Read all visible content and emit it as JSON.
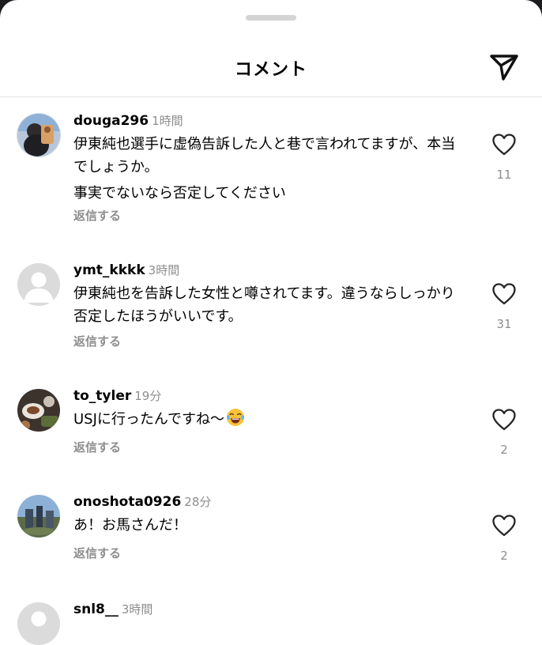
{
  "header": {
    "title": "コメント",
    "share_icon": "paper-plane-icon"
  },
  "comments": [
    {
      "username": "douga296",
      "time": "1時間",
      "lines": [
        "伊東純也選手に虚偽告訴した人と巷で言われてますが、本当でしょうか。",
        "事実でないなら否定してください"
      ],
      "reply_label": "返信する",
      "likes": "11"
    },
    {
      "username": "ymt_kkkk",
      "time": "3時間",
      "lines": [
        "伊東純也を告訴した女性と噂されてます。違うならしっかり否定したほうがいいです。"
      ],
      "reply_label": "返信する",
      "likes": "31"
    },
    {
      "username": "to_tyler",
      "time": "19分",
      "lines": [
        "USJに行ったんですね〜"
      ],
      "emoji": "tears-of-joy-emoji",
      "reply_label": "返信する",
      "likes": "2"
    },
    {
      "username": "onoshota0926",
      "time": "28分",
      "lines": [
        "あ！お馬さんだ！"
      ],
      "reply_label": "返信する",
      "likes": "2"
    },
    {
      "username": "snl8__",
      "time": "3時間"
    }
  ]
}
